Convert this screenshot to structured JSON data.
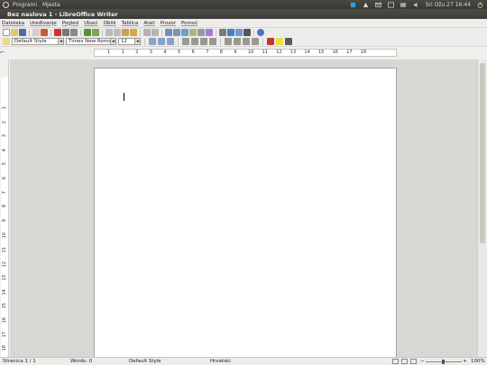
{
  "top_panel": {
    "menus": [
      "Programi",
      "Mjesta"
    ],
    "clock": "Sri Ožu 27 16:44"
  },
  "window": {
    "title": "Bez naslova 1 - LibreOffice Writer"
  },
  "menubar": {
    "items": [
      "Datoteka",
      "Uređivanje",
      "Pogled",
      "Ubaci",
      "Oblik",
      "Tablica",
      "Alati",
      "Prozor",
      "Pomoć"
    ]
  },
  "formatting": {
    "paragraph_style": "Default Style",
    "font_name": "Times New Roman",
    "font_size": "12"
  },
  "ruler": {
    "ticks": [
      "1",
      "1",
      "2",
      "3",
      "4",
      "5",
      "6",
      "7",
      "8",
      "9",
      "10",
      "11",
      "12",
      "13",
      "14",
      "15",
      "16",
      "17",
      "18"
    ]
  },
  "vruler": {
    "ticks": [
      "1",
      "2",
      "3",
      "4",
      "5",
      "6",
      "7",
      "8",
      "9",
      "10",
      "11",
      "12",
      "13",
      "14",
      "15",
      "16",
      "17",
      "18",
      "19"
    ]
  },
  "statusbar": {
    "page": "Stranica 1 / 1",
    "words": "Words: 0",
    "page_style": "Default Style",
    "language": "Hrvatski",
    "zoom": "100%"
  },
  "colors": {
    "panel": "#3c3b37",
    "accent_orange": "#e95420"
  }
}
